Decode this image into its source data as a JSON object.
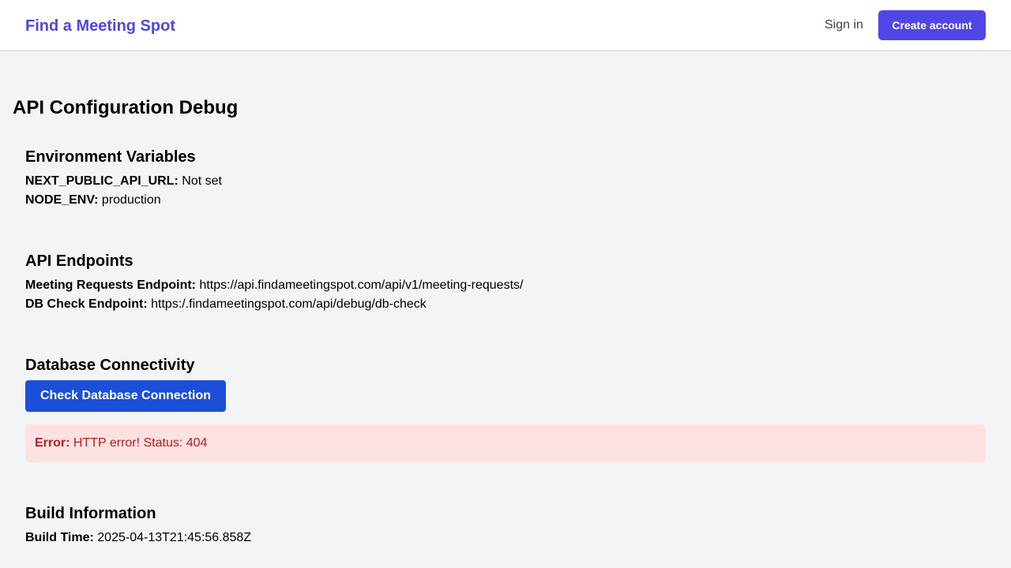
{
  "header": {
    "brand": "Find a Meeting Spot",
    "sign_in": "Sign in",
    "create_account": "Create account"
  },
  "page": {
    "title": "API Configuration Debug"
  },
  "env": {
    "title": "Environment Variables",
    "items": [
      {
        "key": "NEXT_PUBLIC_API_URL:",
        "value": "Not set"
      },
      {
        "key": "NODE_ENV:",
        "value": "production"
      }
    ]
  },
  "endpoints": {
    "title": "API Endpoints",
    "items": [
      {
        "key": "Meeting Requests Endpoint:",
        "value": "https://api.findameetingspot.com/api/v1/meeting-requests/"
      },
      {
        "key": "DB Check Endpoint:",
        "value": "https:/.findameetingspot.com/api/debug/db-check"
      }
    ]
  },
  "db": {
    "title": "Database Connectivity",
    "button": "Check Database Connection",
    "error_label": "Error:",
    "error_message": "HTTP error! Status: 404"
  },
  "build": {
    "title": "Build Information",
    "items": [
      {
        "key": "Build Time:",
        "value": "2025-04-13T21:45:56.858Z"
      }
    ]
  },
  "colors": {
    "brand": "#4f46e5",
    "primary_button": "#1d4ed8",
    "error_bg": "#fee2e2",
    "error_text": "#b91c1c",
    "page_bg": "#f3f4f6"
  }
}
